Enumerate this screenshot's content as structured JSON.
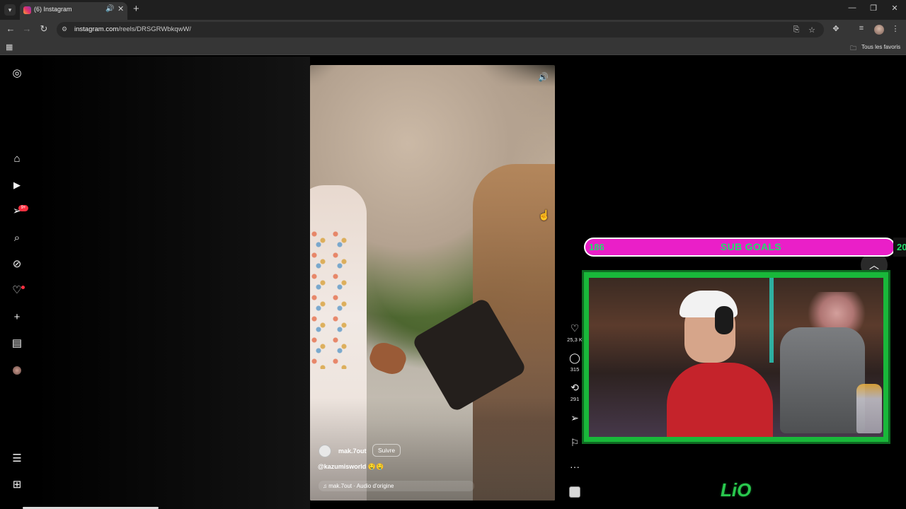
{
  "browser": {
    "tab": {
      "title": "(6) Instagram"
    },
    "url": {
      "host": "instagram.com",
      "path": "/reels/DRSGRWbkqwW/"
    },
    "bookmarks": {
      "all_bookmarks_label": "Tous les favoris"
    }
  },
  "sidebar": {
    "icons": [
      "instagram-logo",
      "home",
      "reels",
      "messages",
      "search",
      "explore",
      "notifications",
      "create",
      "dashboard",
      "profile",
      "more",
      "meta-apps"
    ],
    "messages_badge": "9+"
  },
  "reel": {
    "username": "mak.7out",
    "follow_label": "Suivre",
    "caption": "@kazumisworld 🤤🤤",
    "audio": "mak.7out · Audio d'origine"
  },
  "actions": {
    "likes": "25,3 K",
    "comments": "315",
    "reposts": "291"
  },
  "overlay": {
    "sub_goals": {
      "current": "186",
      "title": "SUB GOALS",
      "target": "20"
    },
    "logo_text": "LiO"
  },
  "colors": {
    "subgoal_bar": "#ea1fc8",
    "subgoal_text": "#1fe06b",
    "webcam_frame": "#19b83a",
    "instagram_red": "#ff3040"
  }
}
